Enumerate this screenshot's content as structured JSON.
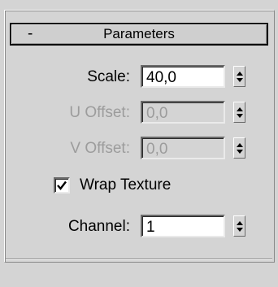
{
  "rollout": {
    "toggle": "-",
    "title": "Parameters"
  },
  "params": {
    "scale": {
      "label": "Scale:",
      "value": "40,0",
      "enabled": true
    },
    "u_offset": {
      "label": "U Offset:",
      "value": "0,0",
      "enabled": false
    },
    "v_offset": {
      "label": "V Offset:",
      "value": "0,0",
      "enabled": false
    },
    "channel": {
      "label": "Channel:",
      "value": "1",
      "enabled": true
    }
  },
  "wrap_texture": {
    "label": "Wrap Texture",
    "checked": true
  },
  "icons": {
    "spinner": "spinner-arrows-icon",
    "check": "checkmark-icon"
  }
}
